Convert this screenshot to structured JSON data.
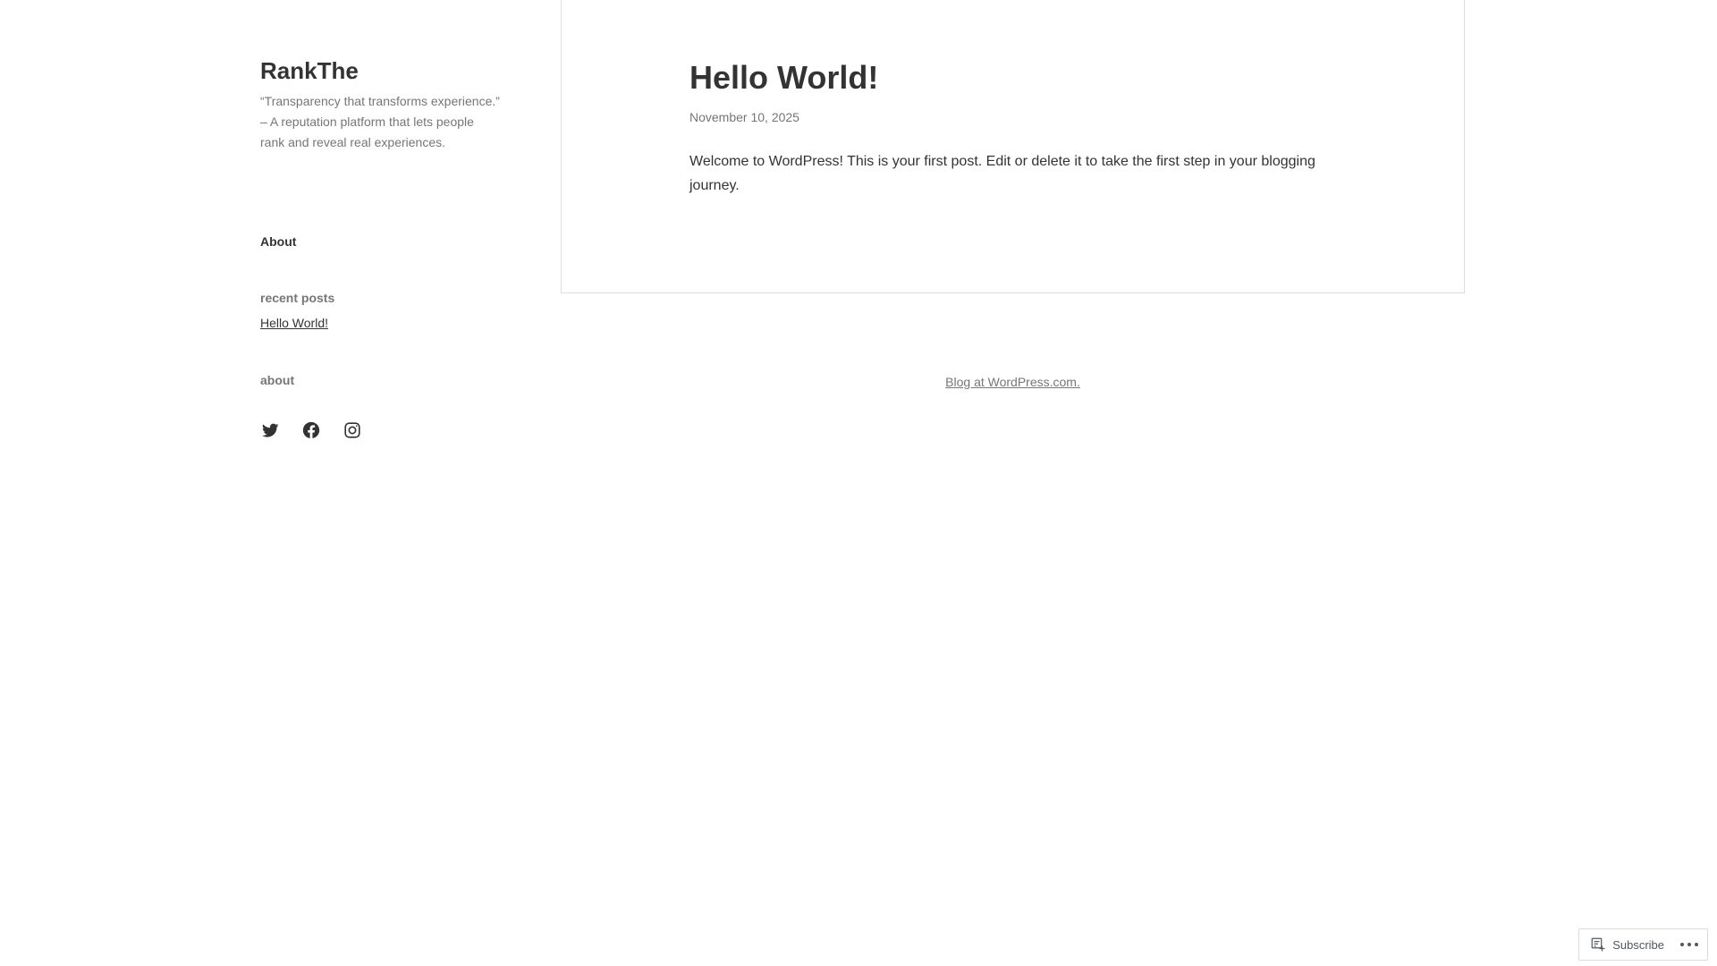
{
  "site": {
    "title": "RankThe",
    "description": "“Transparency that transforms experience.” – A reputation platform that lets people rank and reveal real experiences."
  },
  "sidebar": {
    "menu": [
      {
        "label": "About"
      }
    ],
    "widgets": {
      "recent_posts": {
        "title": "recent posts",
        "items": [
          {
            "label": "Hello World!"
          }
        ]
      },
      "about": {
        "title": "about"
      }
    },
    "social": [
      {
        "icon": "twitter-icon"
      },
      {
        "icon": "facebook-icon"
      },
      {
        "icon": "instagram-icon"
      }
    ]
  },
  "post": {
    "title": "Hello World!",
    "date": "November 10, 2025",
    "content": "Welcome to WordPress! This is your first post. Edit or delete it to take the first step in your blogging journey."
  },
  "footer": {
    "credit": "Blog at WordPress.com."
  },
  "actionbar": {
    "subscribe_label": "Subscribe",
    "more_icon": "ellipsis-icon"
  }
}
